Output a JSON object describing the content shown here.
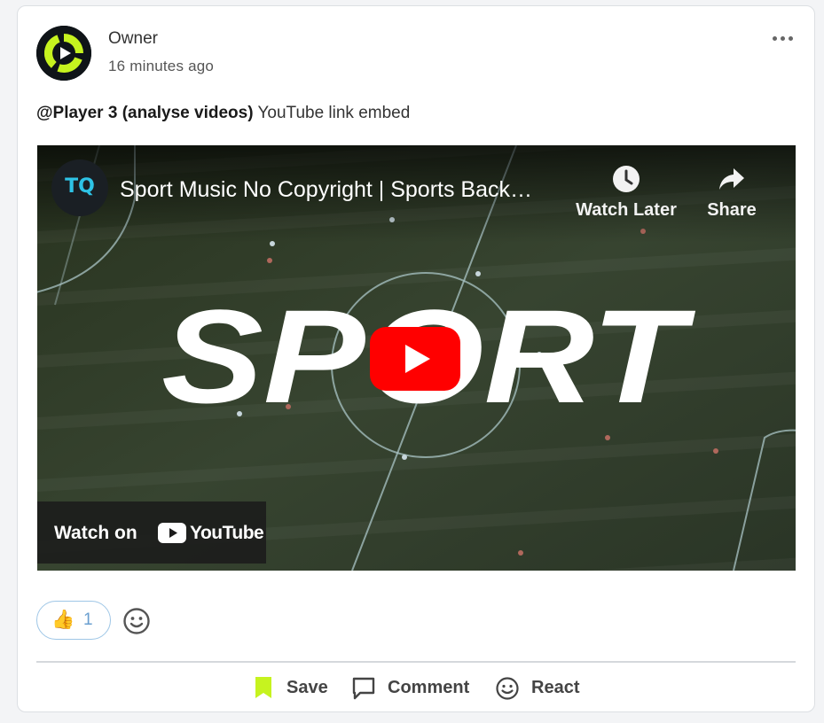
{
  "post": {
    "author": "Owner",
    "time": "16 minutes ago",
    "mention": "@Player 3 (analyse videos)",
    "text": " YouTube link embed"
  },
  "video": {
    "channel_initials": "TQ",
    "title": "Sport Music No Copyright | Sports Back…",
    "watch_later_label": "Watch Later",
    "share_label": "Share",
    "thumbnail_text": "SPORT",
    "watch_on_label": "Watch on",
    "youtube_label": "YouTube"
  },
  "reactions": {
    "emoji": "👍",
    "count": "1"
  },
  "actions": {
    "save_label": "Save",
    "comment_label": "Comment",
    "react_label": "React"
  },
  "colors": {
    "accent": "#c6f31f",
    "youtube_red": "#ff0000",
    "pitch": "#2f3a2a"
  },
  "icons": {
    "more": "more-horizontal-icon",
    "clock": "clock-icon",
    "share": "share-arrow-icon",
    "play": "play-icon",
    "bookmark": "bookmark-icon",
    "comment": "comment-icon",
    "smiley": "smiley-icon"
  }
}
